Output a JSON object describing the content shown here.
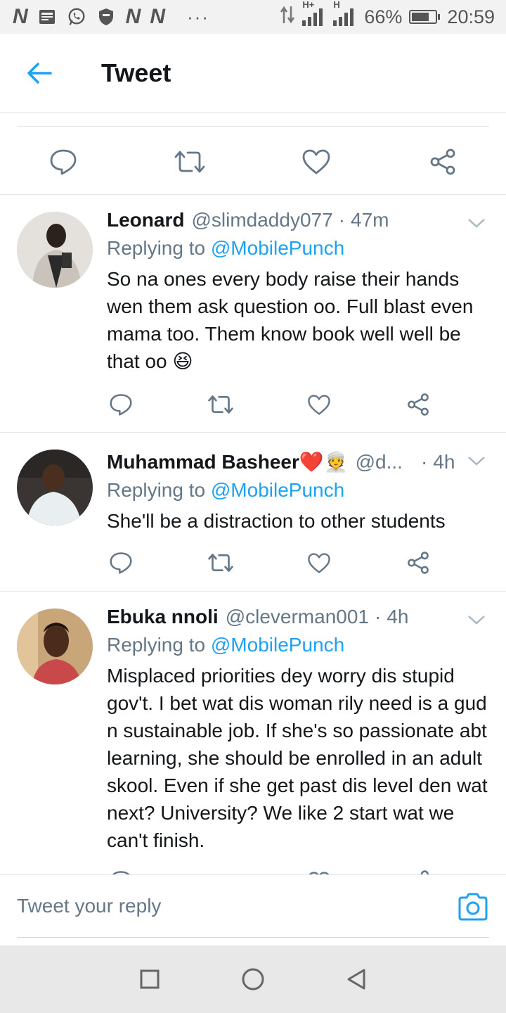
{
  "status_bar": {
    "notif_n1": "N",
    "notif_n2": "N",
    "notif_n3": "N",
    "more": "···",
    "network": "H+",
    "network2": "H",
    "battery": "66%",
    "battery_level": 0.66,
    "time": "20:59"
  },
  "header": {
    "title": "Tweet"
  },
  "colors": {
    "accent": "#1da1f2",
    "icon_gray": "#657786"
  },
  "replies": [
    {
      "name": "Leonard",
      "handle": "@slimdaddy077",
      "sep": "·",
      "time": "47m",
      "replying_prefix": "Replying to ",
      "replying_to": "@MobilePunch",
      "text": "So na ones every body raise their hands wen them ask question oo. Full blast even mama too. Them know book well well be that oo 😆"
    },
    {
      "name": "Muhammad Basheer❤️👳",
      "handle": "@d...",
      "sep": "·",
      "time": "4h",
      "replying_prefix": "Replying to ",
      "replying_to": "@MobilePunch",
      "text": "She'll be a distraction to other students"
    },
    {
      "name": "Ebuka nnoli",
      "handle": "@cleverman001",
      "sep": "·",
      "time": "4h",
      "replying_prefix": "Replying to ",
      "replying_to": "@MobilePunch",
      "text": "Misplaced priorities dey worry dis stupid gov't. I bet wat dis woman rily need is a gud n sustainable job. If she's so passionate abt learning, she should be enrolled in an adult skool. Even if she get past dis level den wat next? University? We like 2 start wat we can't  finish."
    }
  ],
  "composer": {
    "placeholder": "Tweet your reply"
  },
  "icons": {
    "back": "arrow-left-icon",
    "reply": "speech-bubble-icon",
    "retweet": "retweet-icon",
    "like": "heart-icon",
    "share": "share-icon",
    "chevron": "chevron-down-icon",
    "camera": "camera-icon"
  }
}
